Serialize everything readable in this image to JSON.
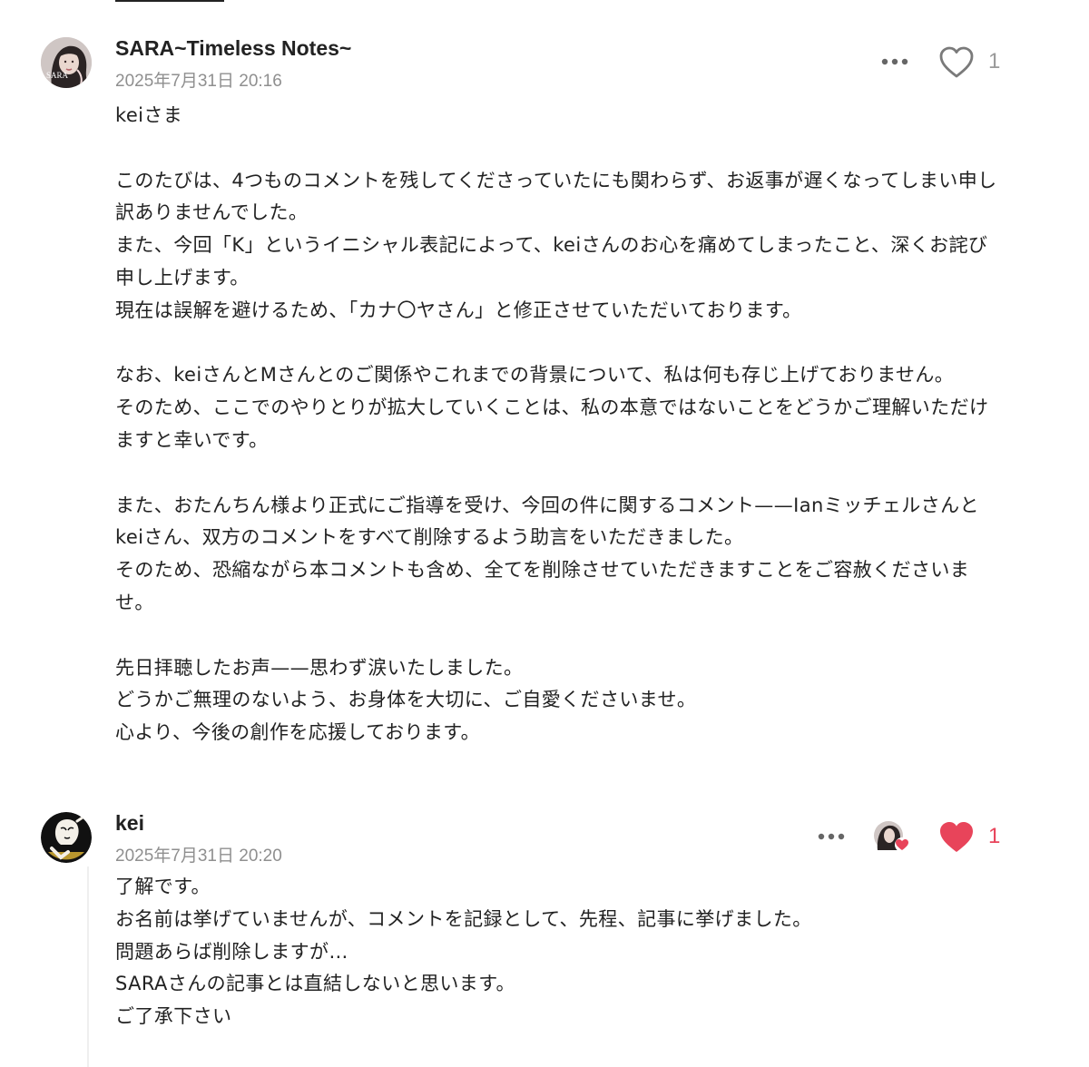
{
  "comments": [
    {
      "author": "SARA~Timeless Notes~",
      "avatar_icon": "woman-portrait-avatar",
      "avatar_caption": "SARA",
      "timestamp": "2025年7月31日 20:16",
      "more_icon": "ellipsis-icon",
      "like_icon": "heart-outline-icon",
      "liked": false,
      "like_count": "1",
      "body": [
        "keiさま",
        "",
        "このたびは、4つものコメントを残してくださっていたにも関わらず、お返事が遅くなってしまい申し訳ありませんでした。",
        "また、今回「K」というイニシャル表記によって、keiさんのお心を痛めてしまったこと、深くお詫び申し上げます。",
        "現在は誤解を避けるため、「カナ〇ヤさん」と修正させていただいております。",
        "",
        "なお、keiさんとMさんとのご関係やこれまでの背景について、私は何も存じ上げておりません。",
        "そのため、ここでのやりとりが拡大していくことは、私の本意ではないことをどうかご理解いただけますと幸いです。",
        "",
        "また、おたんちん様より正式にご指導を受け、今回の件に関するコメント——Ianミッチェルさんとkeiさん、双方のコメントをすべて削除するよう助言をいただきました。",
        "そのため、恐縮ながら本コメントも含め、全てを削除させていただきますことをご容赦くださいませ。",
        "",
        "先日拝聴したお声——思わず涙いたしました。",
        "どうかご無理のないよう、お身体を大切に、ご自愛くださいませ。",
        "心より、今後の創作を応援しております。"
      ]
    },
    {
      "author": "kei",
      "avatar_icon": "line-art-avatar",
      "timestamp": "2025年7月31日 20:20",
      "more_icon": "ellipsis-icon",
      "liker_icon": "author-liked-avatar",
      "like_icon": "heart-filled-icon",
      "liked": true,
      "like_count": "1",
      "body": [
        "了解です。",
        "お名前は挙げていませんが、コメントを記録として、先程、記事に挙げました。",
        "問題あらば削除しますが…",
        "SARAさんの記事とは直結しないと思います。",
        "ご了承下さい"
      ]
    }
  ],
  "colors": {
    "text": "#222222",
    "meta": "#8f8f8f",
    "like_active": "#e8445a",
    "like_inactive": "#9a9a9a"
  }
}
